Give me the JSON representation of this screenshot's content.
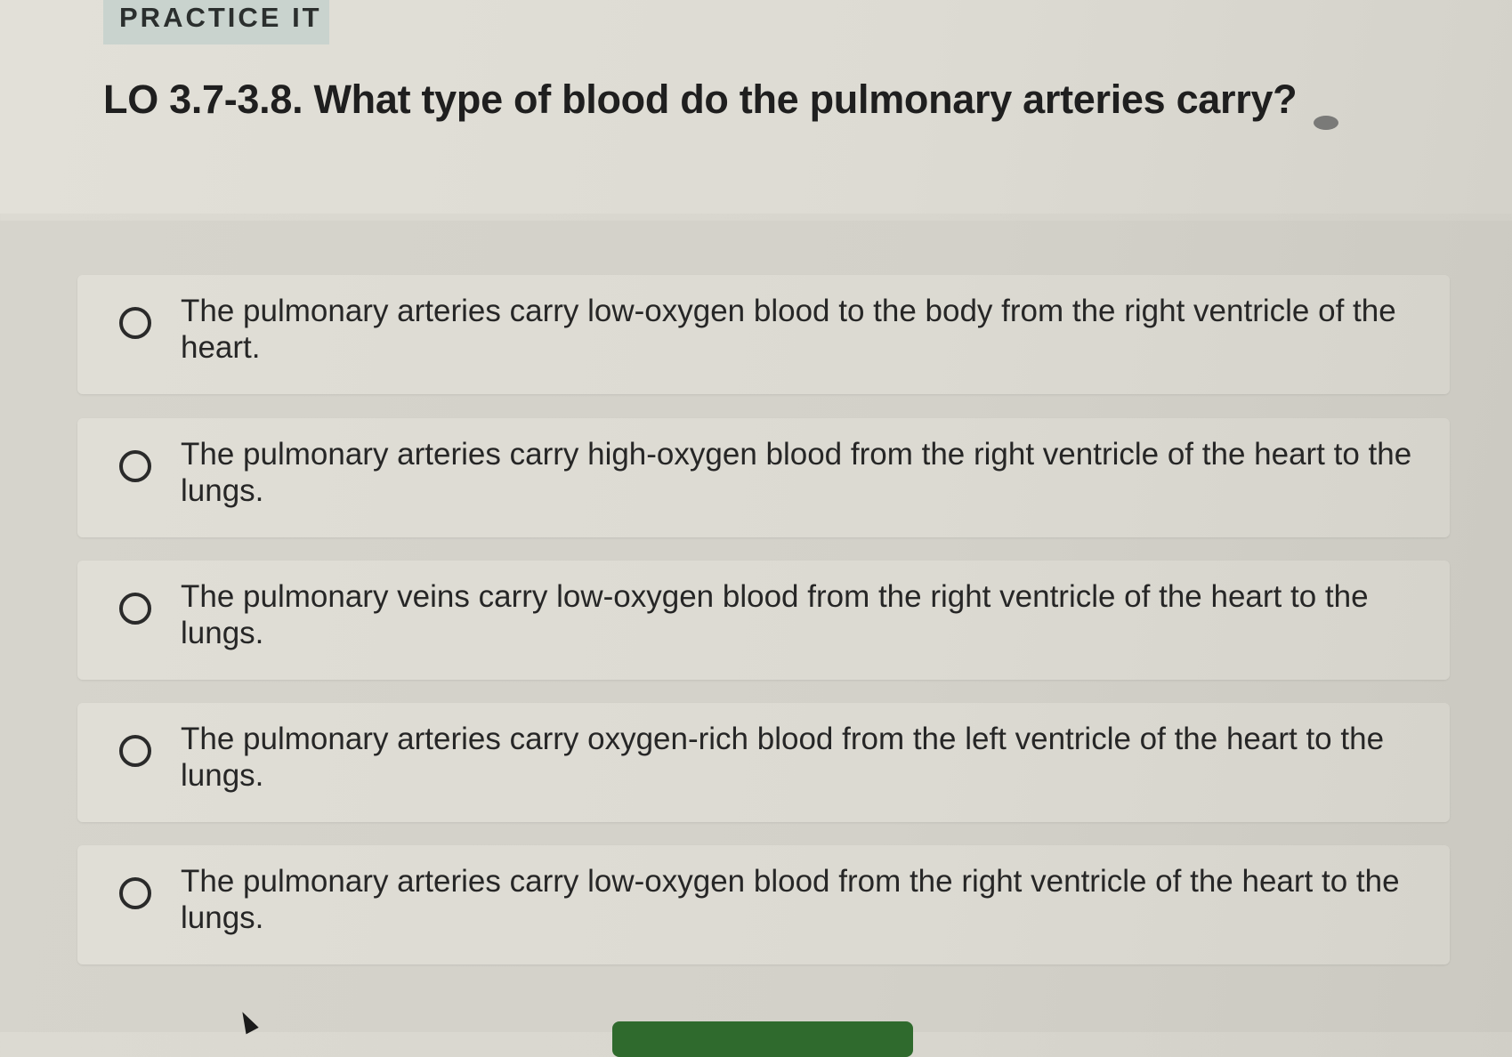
{
  "header": {
    "section_label": "PRACTICE IT",
    "question": "LO 3.7-3.8. What type of blood do the pulmonary arteries carry?"
  },
  "options": [
    {
      "label": "The pulmonary arteries carry low-oxygen blood to the body from the right ventricle of the heart."
    },
    {
      "label": "The pulmonary arteries carry high-oxygen blood from the right ventricle of the heart to the lungs."
    },
    {
      "label": "The pulmonary veins carry low-oxygen blood from the right ventricle of the heart to the lungs."
    },
    {
      "label": "The pulmonary arteries carry oxygen-rich blood from the left ventricle of the heart to the lungs."
    },
    {
      "label": "The pulmonary arteries carry low-oxygen blood from the right ventricle of the heart to the lungs."
    }
  ],
  "colors": {
    "badge": "#c9d3ce",
    "submit": "#2f6a2d",
    "background": "#d8d6ce"
  }
}
